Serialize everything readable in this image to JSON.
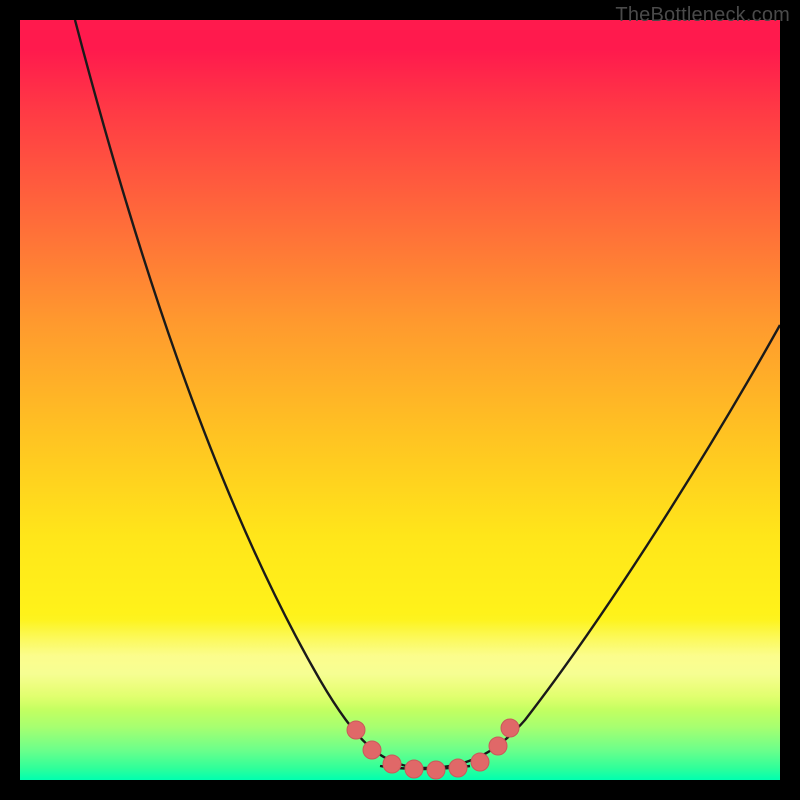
{
  "watermark": {
    "text": "TheBottleneck.com"
  },
  "colors": {
    "frame_bg": "#000000",
    "curve_stroke": "#1a1a1a",
    "marker_fill": "#e06868",
    "marker_stroke": "#c45050"
  },
  "chart_data": {
    "type": "line",
    "title": "",
    "xlabel": "",
    "ylabel": "",
    "xlim": [
      0,
      100
    ],
    "ylim": [
      0,
      100
    ],
    "grid": false,
    "legend": false,
    "note": "V-shaped bottleneck curve; y interpreted as 'bottleneck %' (0 = green/good at bottom, 100 = red/bad at top). Values estimated from pixel positions.",
    "series": [
      {
        "name": "curve",
        "x": [
          0,
          3,
          6,
          10,
          14,
          18,
          22,
          26,
          30,
          34,
          38,
          42,
          45,
          48,
          50,
          52,
          55,
          58,
          60,
          63,
          66,
          70,
          74,
          78,
          82,
          86,
          90,
          94,
          98,
          100
        ],
        "y": [
          100,
          94,
          88,
          80,
          71,
          63,
          55,
          47,
          39,
          31,
          23,
          15,
          9,
          4,
          1,
          0,
          0,
          0,
          1,
          3,
          6,
          11,
          17,
          23,
          30,
          37,
          44,
          51,
          57,
          60
        ]
      }
    ],
    "markers": {
      "name": "highlight-points",
      "x": [
        45,
        47.5,
        50,
        52.5,
        55,
        57.5,
        60,
        62,
        63.5
      ],
      "y": [
        7,
        3,
        1,
        0,
        0,
        0,
        1,
        3,
        6
      ]
    }
  }
}
